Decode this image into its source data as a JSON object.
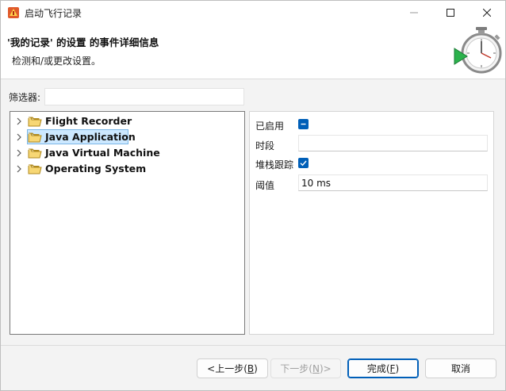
{
  "window": {
    "title": "启动飞行记录"
  },
  "banner": {
    "title": "'我的记录' 的设置 的事件详细信息",
    "description": "检测和/或更改设置。"
  },
  "filter": {
    "label": "筛选器:",
    "value": ""
  },
  "tree": {
    "items": [
      {
        "label": "Flight Recorder"
      },
      {
        "label": "Java Application"
      },
      {
        "label": "Java Virtual Machine"
      },
      {
        "label": "Operating System"
      }
    ],
    "selected_index": 1
  },
  "properties": {
    "enabled_label": "已启用",
    "enabled_state": "indeterminate",
    "period_label": "时段",
    "period_value": "",
    "stacktrace_label": "堆栈跟踪",
    "stacktrace_checked": true,
    "threshold_label": "阈值",
    "threshold_value": "10 ms"
  },
  "buttons": {
    "back_pre": "<上一步(",
    "back_key": "B",
    "back_post": ")",
    "next_pre": "下一步(",
    "next_key": "N",
    "next_post": ")>",
    "finish_pre": "完成(",
    "finish_key": "F",
    "finish_post": ")",
    "cancel": "取消"
  },
  "colors": {
    "accent": "#005fb8",
    "selection": "#cce8ff",
    "folder": "#e8b93a"
  }
}
